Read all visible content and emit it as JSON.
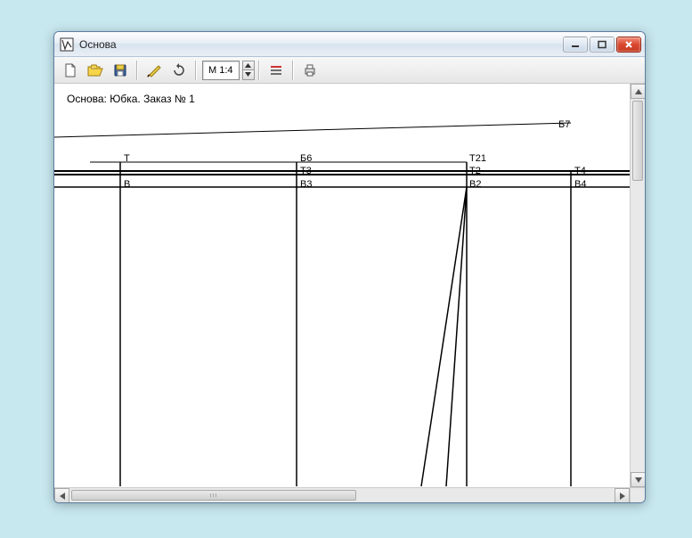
{
  "window": {
    "title": "Основа"
  },
  "toolbar": {
    "scale": "М 1:4"
  },
  "doc": {
    "title": "Основа: Юбка. Заказ № 1"
  },
  "labels": {
    "b7": "Б7",
    "t": "Т",
    "b6": "Б6",
    "t21": "Т21",
    "t3": "Т3",
    "t2": "Т2",
    "t4": "Т4",
    "v": "В",
    "v3": "В3",
    "v2": "В2",
    "v4": "В4"
  }
}
